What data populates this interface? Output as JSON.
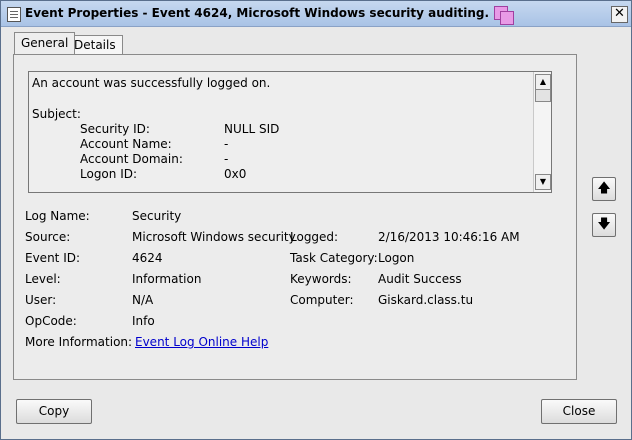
{
  "window": {
    "title": "Event Properties - Event 4624, Microsoft Windows security auditing.",
    "close_glyph": "✕"
  },
  "tabs": [
    {
      "label": "General",
      "active": true
    },
    {
      "label": "Details",
      "active": false
    }
  ],
  "description": {
    "headline": "An account was successfully logged on.",
    "subject_label": "Subject:",
    "rows": [
      {
        "label": "Security ID:",
        "value": "NULL SID"
      },
      {
        "label": "Account Name:",
        "value": "-"
      },
      {
        "label": "Account Domain:",
        "value": "-"
      },
      {
        "label": "Logon ID:",
        "value": "0x0"
      }
    ]
  },
  "fields": {
    "log_name": {
      "label": "Log Name:",
      "value": "Security"
    },
    "source": {
      "label": "Source:",
      "value": "Microsoft Windows security"
    },
    "logged": {
      "label": "Logged:",
      "value": "2/16/2013 10:46:16 AM"
    },
    "event_id": {
      "label": "Event ID:",
      "value": "4624"
    },
    "task_category": {
      "label": "Task Category:",
      "value": "Logon"
    },
    "level": {
      "label": "Level:",
      "value": "Information"
    },
    "keywords": {
      "label": "Keywords:",
      "value": "Audit Success"
    },
    "user": {
      "label": "User:",
      "value": "N/A"
    },
    "computer": {
      "label": "Computer:",
      "value": "Giskard.class.tu"
    },
    "opcode": {
      "label": "OpCode:",
      "value": "Info"
    },
    "more_info": {
      "label": "More Information:",
      "link": "Event Log Online Help"
    }
  },
  "nav": {
    "up_glyph": "🡅",
    "down_glyph": "🡇"
  },
  "buttons": {
    "copy": "Copy",
    "close": "Close"
  },
  "icons": {
    "up": "arrow-up-icon",
    "down": "arrow-down-icon",
    "app": "event-viewer-icon"
  }
}
